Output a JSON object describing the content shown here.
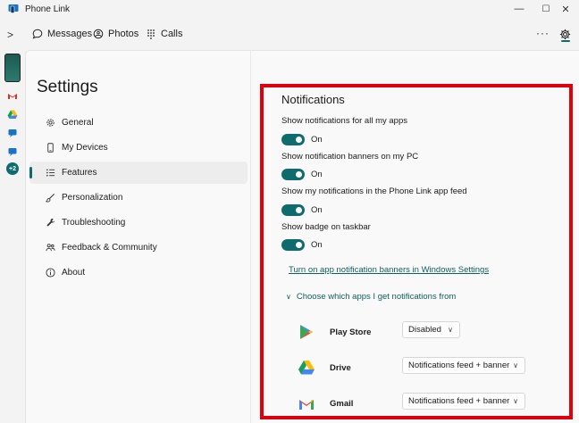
{
  "window": {
    "title": "Phone Link",
    "minimize": "—",
    "maximize": "☐",
    "close": "✕"
  },
  "tabbar": {
    "expand_icon": ">",
    "tabs": [
      {
        "label": "Messages",
        "icon": "chat-icon"
      },
      {
        "label": "Photos",
        "icon": "photos-icon"
      },
      {
        "label": "Calls",
        "icon": "dialpad-icon"
      }
    ],
    "more": "···"
  },
  "rail": {
    "more_apps_badge": "+2"
  },
  "settings": {
    "title": "Settings",
    "nav": [
      {
        "label": "General",
        "icon": "gear-icon"
      },
      {
        "label": "My Devices",
        "icon": "phone-icon"
      },
      {
        "label": "Features",
        "icon": "list-icon",
        "selected": true
      },
      {
        "label": "Personalization",
        "icon": "brush-icon"
      },
      {
        "label": "Troubleshooting",
        "icon": "wrench-icon"
      },
      {
        "label": "Feedback & Community",
        "icon": "people-icon"
      },
      {
        "label": "About",
        "icon": "info-icon"
      }
    ]
  },
  "notifications": {
    "title": "Notifications",
    "settings": [
      {
        "label": "Show notifications for all my apps",
        "state": "On"
      },
      {
        "label": "Show notification banners on my PC",
        "state": "On"
      },
      {
        "label": "Show my notifications in the Phone Link app feed",
        "state": "On"
      },
      {
        "label": "Show badge on taskbar",
        "state": "On"
      }
    ],
    "link": "Turn on app notification banners in Windows Settings",
    "chooser": "Choose which apps I get notifications from",
    "apps": [
      {
        "name": "Play Store",
        "value": "Disabled",
        "icon": "play-store-icon"
      },
      {
        "name": "Drive",
        "value": "Notifications feed + banner",
        "icon": "drive-icon"
      },
      {
        "name": "Gmail",
        "value": "Notifications feed + banner",
        "icon": "gmail-icon"
      }
    ]
  },
  "colors": {
    "accent": "#0f6c6e",
    "highlight_border": "#e0000b"
  }
}
